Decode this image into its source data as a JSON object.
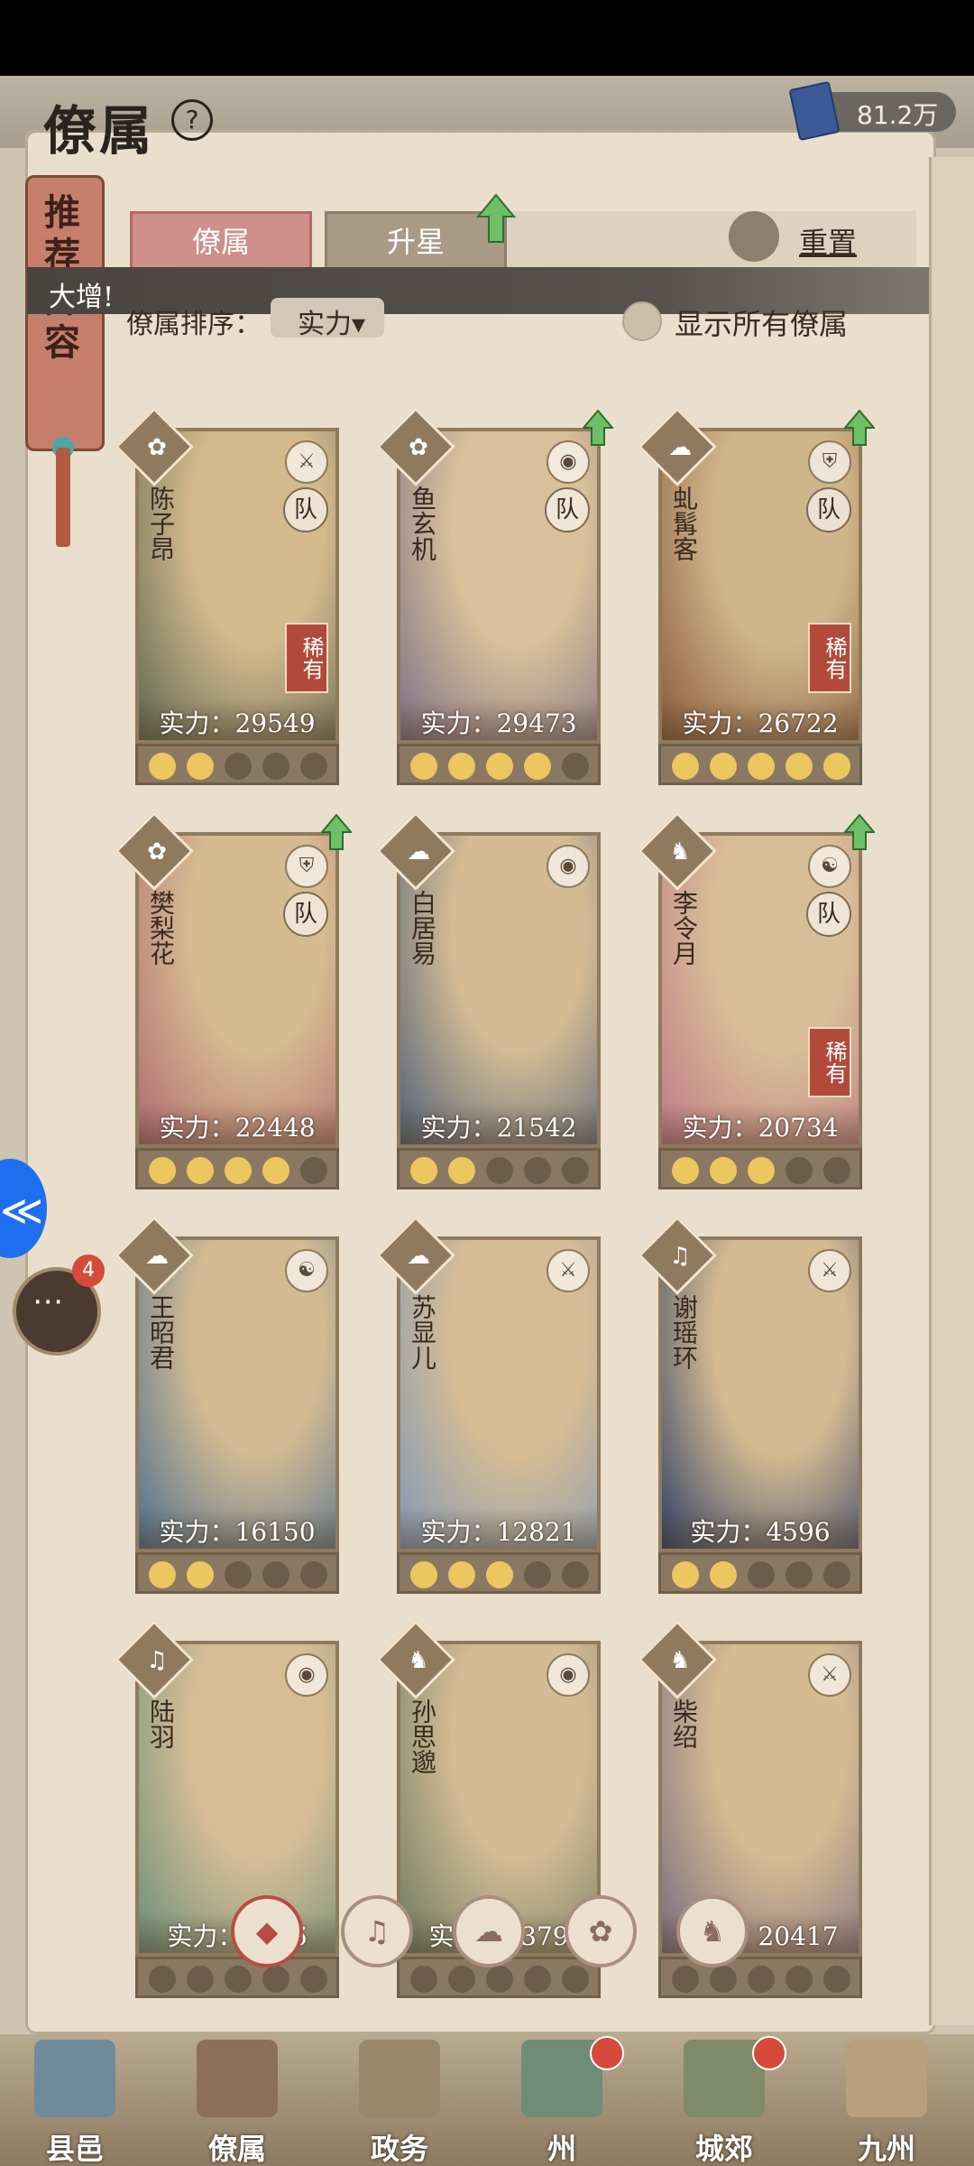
{
  "header": {
    "title": "僚属",
    "currency_value": "81.2万",
    "help_icon": "?"
  },
  "side_tag": {
    "label": "推荐阵容"
  },
  "tabs": [
    {
      "label": "僚属"
    },
    {
      "label": "升星"
    }
  ],
  "reset_label": "重置",
  "toast": "大增!",
  "sort": {
    "label": "僚属排序：",
    "value": "实力▾"
  },
  "show_all": {
    "label": "显示所有僚属"
  },
  "cards": [
    {
      "name": "陈子昂",
      "power": "实力：29549",
      "stars": 2,
      "team": "队",
      "rare": "稀有",
      "type_icon": "fan-icon",
      "class_icon": "sword-icon",
      "up": false
    },
    {
      "name": "鱼玄机",
      "power": "实力：29473",
      "stars": 4,
      "team": "队",
      "rare": "",
      "type_icon": "fan-icon",
      "class_icon": "bell-icon",
      "up": true
    },
    {
      "name": "虬髯客",
      "power": "实力：26722",
      "stars": 5,
      "team": "队",
      "rare": "稀有",
      "type_icon": "gourd-icon",
      "class_icon": "shield-icon",
      "up": true
    },
    {
      "name": "樊梨花",
      "power": "实力：22448",
      "stars": 4,
      "team": "队",
      "rare": "",
      "type_icon": "fan-icon",
      "class_icon": "shield-icon",
      "up": true
    },
    {
      "name": "白居易",
      "power": "实力：21542",
      "stars": 2,
      "team": "",
      "rare": "",
      "type_icon": "gourd-icon",
      "class_icon": "bell-icon",
      "up": false
    },
    {
      "name": "李令月",
      "power": "实力：20734",
      "stars": 3,
      "team": "队",
      "rare": "稀有",
      "type_icon": "horse-icon",
      "class_icon": "yinyang-icon",
      "up": true
    },
    {
      "name": "王昭君",
      "power": "实力：16150",
      "stars": 2,
      "team": "",
      "rare": "",
      "type_icon": "gourd-icon",
      "class_icon": "yinyang-icon",
      "up": false
    },
    {
      "name": "苏显儿",
      "power": "实力：12821",
      "stars": 3,
      "team": "",
      "rare": "",
      "type_icon": "gourd-icon",
      "class_icon": "sword-icon",
      "up": false
    },
    {
      "name": "谢瑶环",
      "power": "实力：4596",
      "stars": 2,
      "team": "",
      "rare": "",
      "type_icon": "bell-icon",
      "class_icon": "sword-icon",
      "up": false
    },
    {
      "name": "陆羽",
      "power": "实力：4456",
      "stars": 0,
      "team": "",
      "rare": "",
      "type_icon": "bell-icon",
      "class_icon": "bell-icon",
      "up": false
    },
    {
      "name": "孙思邈",
      "power": "实力：3379",
      "stars": 0,
      "team": "",
      "rare": "",
      "type_icon": "horse-icon",
      "class_icon": "bell-icon",
      "up": false
    },
    {
      "name": "柴绍",
      "power": "实力：20417",
      "stars": 0,
      "team": "",
      "rare": "",
      "type_icon": "horse-icon",
      "class_icon": "sword-icon",
      "up": false
    }
  ],
  "filters": [
    {
      "name": "all-filter-icon",
      "glyph": "◆",
      "active": true
    },
    {
      "name": "bell-filter-icon",
      "glyph": "♫",
      "active": false
    },
    {
      "name": "gourd-filter-icon",
      "glyph": "☁",
      "active": false
    },
    {
      "name": "fan-filter-icon",
      "glyph": "✿",
      "active": false
    },
    {
      "name": "horse-filter-icon",
      "glyph": "♞",
      "active": false
    }
  ],
  "nav": [
    {
      "label": "县邑",
      "dot": false
    },
    {
      "label": "僚属",
      "dot": false
    },
    {
      "label": "政务",
      "dot": false
    },
    {
      "label": "州",
      "dot": true
    },
    {
      "label": "城郊",
      "dot": true
    },
    {
      "label": "九州",
      "dot": false
    }
  ],
  "chat_badge": "4",
  "colors": {
    "accent": "#b84c44",
    "paper": "#e9dfcc",
    "frame": "#8f7a5e",
    "star_on": "#ecc65e"
  }
}
